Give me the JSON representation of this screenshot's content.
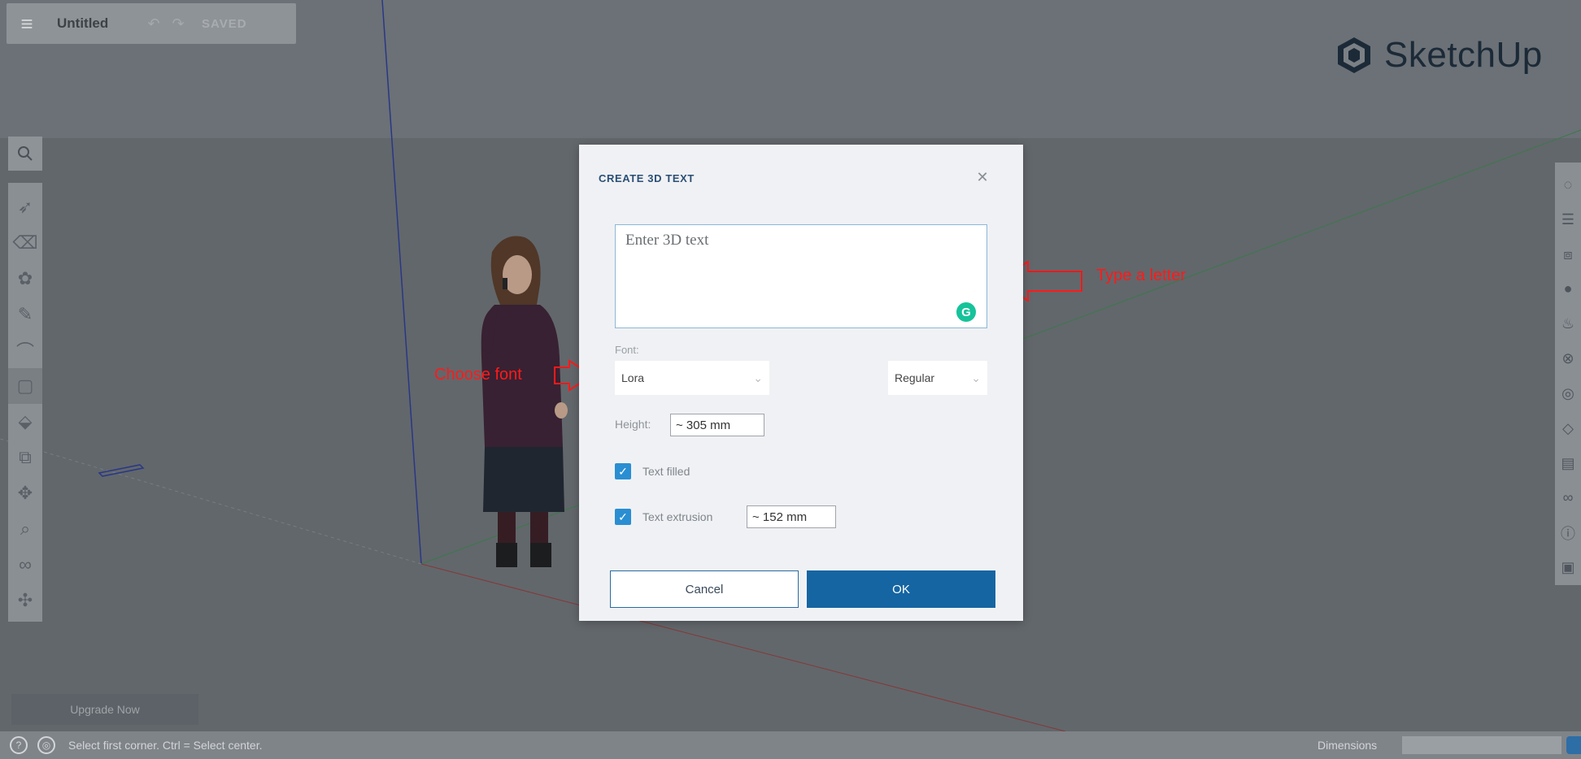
{
  "app": {
    "title": "Untitled",
    "saved_label": "SAVED",
    "brand_name": "SketchUp",
    "menu_icon": "hamburger-menu-icon",
    "undo_icon": "undo-icon",
    "redo_icon": "redo-icon"
  },
  "left_toolbar": {
    "search_icon": "search-icon",
    "tools": [
      {
        "name": "select-icon",
        "glyph": "➶"
      },
      {
        "name": "eraser-icon",
        "glyph": "⌫"
      },
      {
        "name": "paint-bucket-icon",
        "glyph": "✿"
      },
      {
        "name": "pencil-icon",
        "glyph": "✎"
      },
      {
        "name": "arc-icon",
        "glyph": "⌒"
      },
      {
        "name": "rectangle-icon",
        "glyph": "▢"
      },
      {
        "name": "push-pull-icon",
        "glyph": "⬙"
      },
      {
        "name": "move-icon",
        "glyph": "⧉"
      },
      {
        "name": "orbit-icon",
        "glyph": "✥"
      },
      {
        "name": "tape-measure-icon",
        "glyph": "⌕"
      },
      {
        "name": "walk-icon",
        "glyph": "∞"
      },
      {
        "name": "section-icon",
        "glyph": "✣"
      }
    ]
  },
  "right_toolbar": {
    "tools": [
      {
        "name": "entity-info-icon",
        "glyph": "◌"
      },
      {
        "name": "instructor-icon",
        "glyph": "☰"
      },
      {
        "name": "components-icon",
        "glyph": "⧈"
      },
      {
        "name": "materials-icon",
        "glyph": "●"
      },
      {
        "name": "styles-icon",
        "glyph": "♨"
      },
      {
        "name": "layers-icon",
        "glyph": "⊗"
      },
      {
        "name": "outliner-icon",
        "glyph": "◎"
      },
      {
        "name": "scenes-icon",
        "glyph": "◇"
      },
      {
        "name": "display-icon",
        "glyph": "▤"
      },
      {
        "name": "shadows-icon",
        "glyph": "∞"
      },
      {
        "name": "info-icon",
        "glyph": "ⓘ"
      },
      {
        "name": "report-icon",
        "glyph": "▣"
      }
    ]
  },
  "upgrade_label": "Upgrade Now",
  "status": {
    "help_icon": "help-icon",
    "globe_icon": "globe-icon",
    "hint": "Select first corner. Ctrl = Select center.",
    "dimensions_label": "Dimensions"
  },
  "annotations": {
    "type_text": "Type a letter",
    "choose_font": "Choose font"
  },
  "dialog": {
    "title": "CREATE 3D TEXT",
    "close_icon": "close-icon",
    "text_placeholder": "Enter 3D text",
    "text_value": "",
    "grammarly_icon": "grammarly-icon",
    "font_label": "Font:",
    "font_value": "Lora",
    "style_value": "Regular",
    "height_label": "Height:",
    "height_value": "~ 305 mm",
    "text_filled_label": "Text filled",
    "text_filled_checked": true,
    "text_extrusion_label": "Text extrusion",
    "text_extrusion_checked": true,
    "extrusion_value": "~ 152 mm",
    "cancel_label": "Cancel",
    "ok_label": "OK"
  },
  "colors": {
    "primary": "#1565a3",
    "checkbox": "#2a8ed2",
    "annotation": "#ff1a1a",
    "title": "#2a4f76"
  }
}
